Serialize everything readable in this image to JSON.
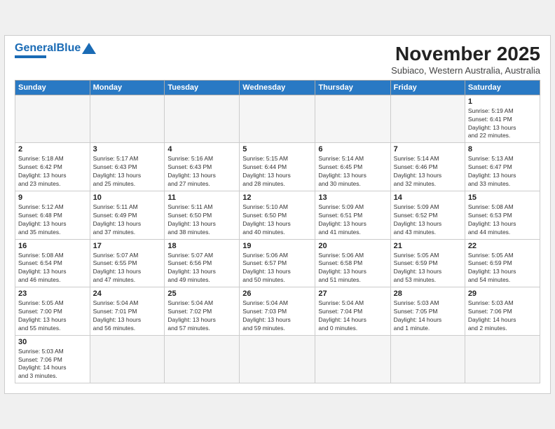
{
  "header": {
    "logo_general": "General",
    "logo_blue": "Blue",
    "month_title": "November 2025",
    "subtitle": "Subiaco, Western Australia, Australia"
  },
  "weekdays": [
    "Sunday",
    "Monday",
    "Tuesday",
    "Wednesday",
    "Thursday",
    "Friday",
    "Saturday"
  ],
  "weeks": [
    [
      {
        "day": "",
        "info": ""
      },
      {
        "day": "",
        "info": ""
      },
      {
        "day": "",
        "info": ""
      },
      {
        "day": "",
        "info": ""
      },
      {
        "day": "",
        "info": ""
      },
      {
        "day": "",
        "info": ""
      },
      {
        "day": "1",
        "info": "Sunrise: 5:19 AM\nSunset: 6:41 PM\nDaylight: 13 hours\nand 22 minutes."
      }
    ],
    [
      {
        "day": "2",
        "info": "Sunrise: 5:18 AM\nSunset: 6:42 PM\nDaylight: 13 hours\nand 23 minutes."
      },
      {
        "day": "3",
        "info": "Sunrise: 5:17 AM\nSunset: 6:43 PM\nDaylight: 13 hours\nand 25 minutes."
      },
      {
        "day": "4",
        "info": "Sunrise: 5:16 AM\nSunset: 6:43 PM\nDaylight: 13 hours\nand 27 minutes."
      },
      {
        "day": "5",
        "info": "Sunrise: 5:15 AM\nSunset: 6:44 PM\nDaylight: 13 hours\nand 28 minutes."
      },
      {
        "day": "6",
        "info": "Sunrise: 5:14 AM\nSunset: 6:45 PM\nDaylight: 13 hours\nand 30 minutes."
      },
      {
        "day": "7",
        "info": "Sunrise: 5:14 AM\nSunset: 6:46 PM\nDaylight: 13 hours\nand 32 minutes."
      },
      {
        "day": "8",
        "info": "Sunrise: 5:13 AM\nSunset: 6:47 PM\nDaylight: 13 hours\nand 33 minutes."
      }
    ],
    [
      {
        "day": "9",
        "info": "Sunrise: 5:12 AM\nSunset: 6:48 PM\nDaylight: 13 hours\nand 35 minutes."
      },
      {
        "day": "10",
        "info": "Sunrise: 5:11 AM\nSunset: 6:49 PM\nDaylight: 13 hours\nand 37 minutes."
      },
      {
        "day": "11",
        "info": "Sunrise: 5:11 AM\nSunset: 6:50 PM\nDaylight: 13 hours\nand 38 minutes."
      },
      {
        "day": "12",
        "info": "Sunrise: 5:10 AM\nSunset: 6:50 PM\nDaylight: 13 hours\nand 40 minutes."
      },
      {
        "day": "13",
        "info": "Sunrise: 5:09 AM\nSunset: 6:51 PM\nDaylight: 13 hours\nand 41 minutes."
      },
      {
        "day": "14",
        "info": "Sunrise: 5:09 AM\nSunset: 6:52 PM\nDaylight: 13 hours\nand 43 minutes."
      },
      {
        "day": "15",
        "info": "Sunrise: 5:08 AM\nSunset: 6:53 PM\nDaylight: 13 hours\nand 44 minutes."
      }
    ],
    [
      {
        "day": "16",
        "info": "Sunrise: 5:08 AM\nSunset: 6:54 PM\nDaylight: 13 hours\nand 46 minutes."
      },
      {
        "day": "17",
        "info": "Sunrise: 5:07 AM\nSunset: 6:55 PM\nDaylight: 13 hours\nand 47 minutes."
      },
      {
        "day": "18",
        "info": "Sunrise: 5:07 AM\nSunset: 6:56 PM\nDaylight: 13 hours\nand 49 minutes."
      },
      {
        "day": "19",
        "info": "Sunrise: 5:06 AM\nSunset: 6:57 PM\nDaylight: 13 hours\nand 50 minutes."
      },
      {
        "day": "20",
        "info": "Sunrise: 5:06 AM\nSunset: 6:58 PM\nDaylight: 13 hours\nand 51 minutes."
      },
      {
        "day": "21",
        "info": "Sunrise: 5:05 AM\nSunset: 6:59 PM\nDaylight: 13 hours\nand 53 minutes."
      },
      {
        "day": "22",
        "info": "Sunrise: 5:05 AM\nSunset: 6:59 PM\nDaylight: 13 hours\nand 54 minutes."
      }
    ],
    [
      {
        "day": "23",
        "info": "Sunrise: 5:05 AM\nSunset: 7:00 PM\nDaylight: 13 hours\nand 55 minutes."
      },
      {
        "day": "24",
        "info": "Sunrise: 5:04 AM\nSunset: 7:01 PM\nDaylight: 13 hours\nand 56 minutes."
      },
      {
        "day": "25",
        "info": "Sunrise: 5:04 AM\nSunset: 7:02 PM\nDaylight: 13 hours\nand 57 minutes."
      },
      {
        "day": "26",
        "info": "Sunrise: 5:04 AM\nSunset: 7:03 PM\nDaylight: 13 hours\nand 59 minutes."
      },
      {
        "day": "27",
        "info": "Sunrise: 5:04 AM\nSunset: 7:04 PM\nDaylight: 14 hours\nand 0 minutes."
      },
      {
        "day": "28",
        "info": "Sunrise: 5:03 AM\nSunset: 7:05 PM\nDaylight: 14 hours\nand 1 minute."
      },
      {
        "day": "29",
        "info": "Sunrise: 5:03 AM\nSunset: 7:06 PM\nDaylight: 14 hours\nand 2 minutes."
      }
    ],
    [
      {
        "day": "30",
        "info": "Sunrise: 5:03 AM\nSunset: 7:06 PM\nDaylight: 14 hours\nand 3 minutes."
      },
      {
        "day": "",
        "info": ""
      },
      {
        "day": "",
        "info": ""
      },
      {
        "day": "",
        "info": ""
      },
      {
        "day": "",
        "info": ""
      },
      {
        "day": "",
        "info": ""
      },
      {
        "day": "",
        "info": ""
      }
    ]
  ]
}
